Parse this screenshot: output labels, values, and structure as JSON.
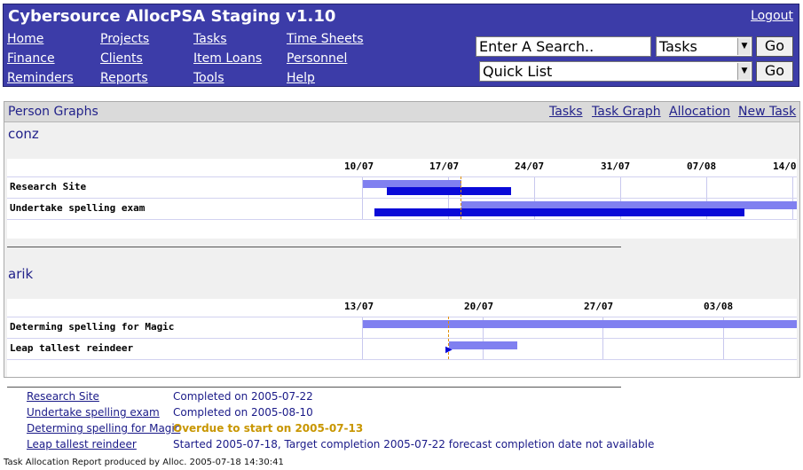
{
  "header": {
    "title": "Cybersource AllocPSA Staging v1.10",
    "logout": "Logout",
    "nav": [
      "Home",
      "Projects",
      "Tasks",
      "Time Sheets",
      "Finance",
      "Clients",
      "Item Loans",
      "Personnel",
      "Reminders",
      "Reports",
      "Tools",
      "Help"
    ],
    "search_value": "Enter A Search..",
    "search_type": "Tasks",
    "quick_list": "Quick List",
    "go": "Go"
  },
  "panel": {
    "title": "Person Graphs",
    "links": [
      "Tasks",
      "Task Graph",
      "Allocation",
      "New Task"
    ]
  },
  "people": [
    {
      "name": "conz",
      "dates": [
        "10/07",
        "17/07",
        "24/07",
        "31/07",
        "07/08",
        "14/0"
      ],
      "tasks": [
        "Research Site",
        "Undertake spelling exam"
      ]
    },
    {
      "name": "arik",
      "dates": [
        "13/07",
        "20/07",
        "27/07",
        "03/08"
      ],
      "tasks": [
        "Determing spelling for Magic",
        "Leap tallest reindeer"
      ]
    }
  ],
  "legend": [
    {
      "task": "Research Site",
      "status": "Completed on 2005-07-22"
    },
    {
      "task": "Undertake spelling exam",
      "status": "Completed on 2005-08-10"
    },
    {
      "task": "Determing spelling for Magic",
      "status": "Overdue to start on 2005-07-13"
    },
    {
      "task": "Leap tallest reindeer",
      "status": "Started 2005-07-18, Target completion 2005-07-22 forecast completion date not available"
    }
  ],
  "footer": "Task Allocation Report produced by Alloc. 2005-07-18 14:30:41",
  "colors": {
    "header_bg": "#3c3ca8",
    "estimate_bar": "#8080f0",
    "actual_bar": "#0a0ad8",
    "today_line": "#e09000",
    "overdue_text": "#c89600"
  }
}
